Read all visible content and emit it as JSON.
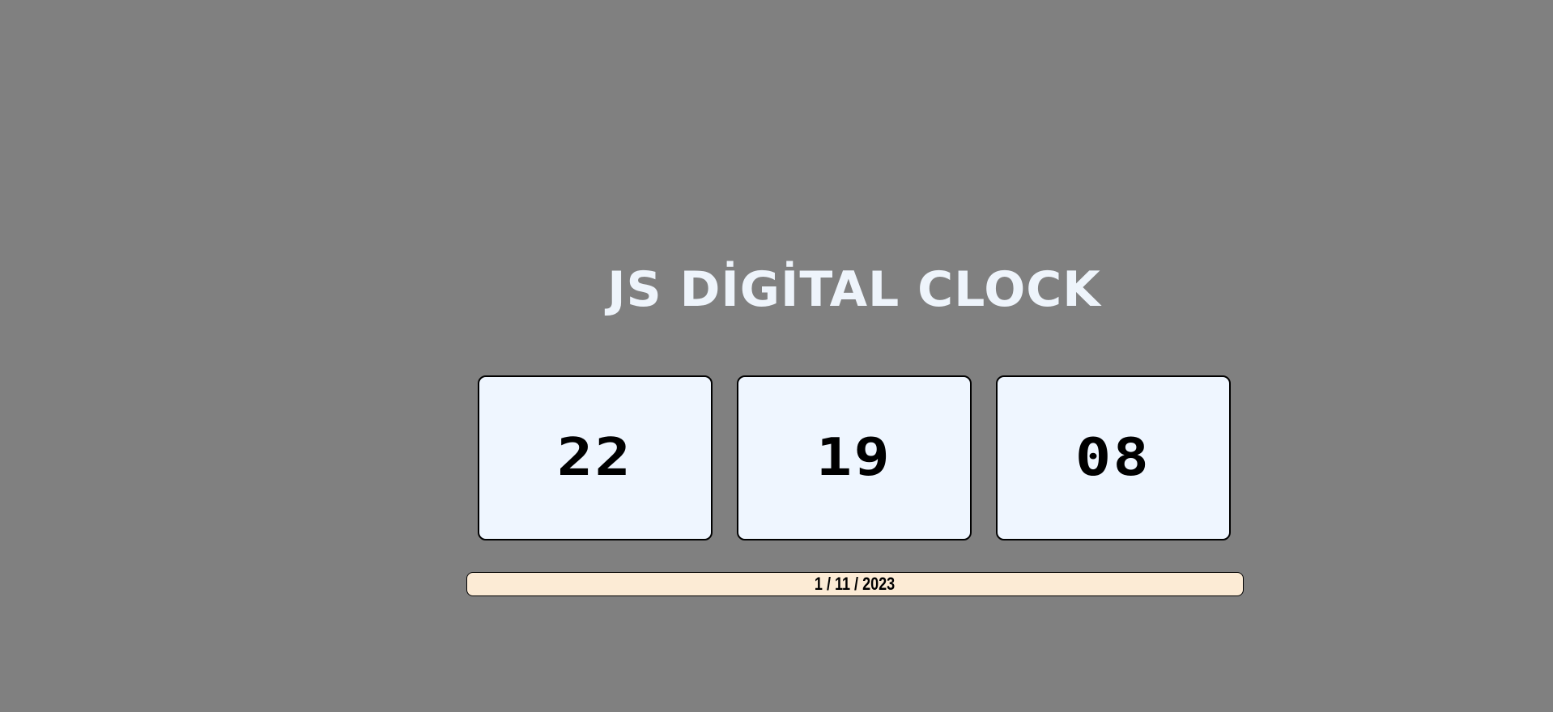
{
  "title": "JS DİGİTAL CLOCK",
  "clock": {
    "hours": "22",
    "minutes": "19",
    "seconds": "08"
  },
  "date": "1 / 11 / 2023",
  "colors": {
    "background": "#808080",
    "title": "#eef4fb",
    "clock_box": "#eff6ff",
    "date_bar": "#fcebd5"
  }
}
